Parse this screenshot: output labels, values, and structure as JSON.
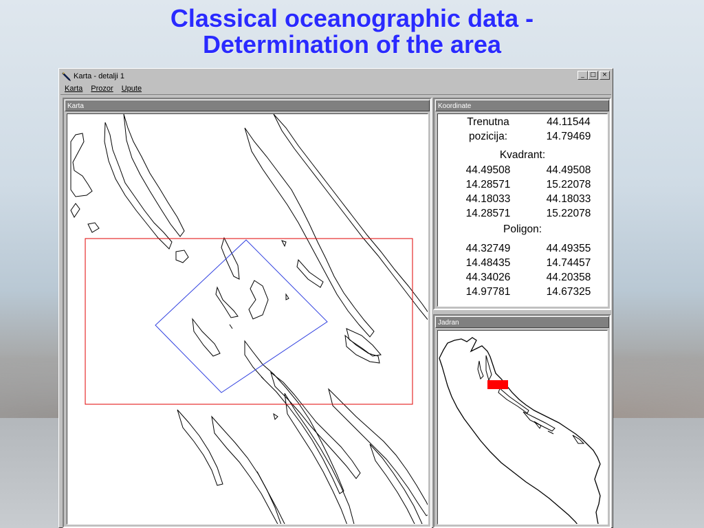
{
  "slide": {
    "title_line1": "Classical oceanographic data -",
    "title_line2": "Determination of the area"
  },
  "window": {
    "title": "Karta - detalji 1",
    "icon": "app-pencil-icon",
    "controls": {
      "minimize": "_",
      "maximize": "□",
      "close": "×"
    },
    "menu": [
      "Karta",
      "Prozor",
      "Upute"
    ]
  },
  "map_pane": {
    "title": "Karta"
  },
  "coord_pane": {
    "title": "Koordinate",
    "current_label_1": "Trenutna",
    "current_label_2": "pozicija:",
    "current_lat": "44.11544",
    "current_lon": "14.79469",
    "quadrant_label": "Kvadrant:",
    "quadrant": [
      [
        "44.49508",
        "44.49508"
      ],
      [
        "14.28571",
        "15.22078"
      ],
      [
        "44.18033",
        "44.18033"
      ],
      [
        "14.28571",
        "15.22078"
      ]
    ],
    "polygon_label": "Poligon:",
    "polygon": [
      [
        "44.32749",
        "44.49355"
      ],
      [
        "14.48435",
        "14.74457"
      ],
      [
        "44.34026",
        "44.20358"
      ],
      [
        "14.97781",
        "14.67325"
      ]
    ]
  },
  "overview_pane": {
    "title": "Jadran"
  },
  "colors": {
    "title_blue": "#2a2aff",
    "quadrant_red": "#e00000",
    "polygon_blue": "#3040e0",
    "highlight_red": "#ff0000"
  }
}
